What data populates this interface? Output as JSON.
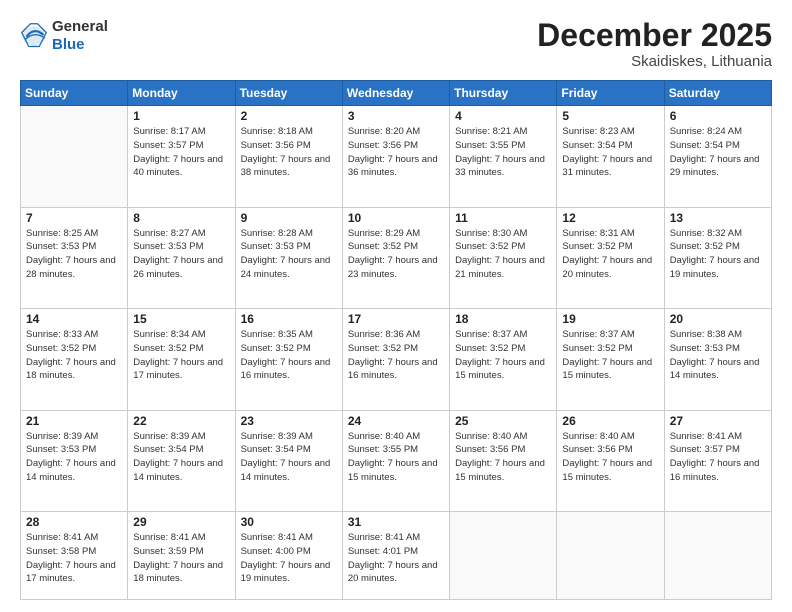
{
  "header": {
    "logo_general": "General",
    "logo_blue": "Blue",
    "month_title": "December 2025",
    "location": "Skaidiskes, Lithuania"
  },
  "days_of_week": [
    "Sunday",
    "Monday",
    "Tuesday",
    "Wednesday",
    "Thursday",
    "Friday",
    "Saturday"
  ],
  "weeks": [
    [
      {
        "day": "",
        "sunrise": "",
        "sunset": "",
        "daylight": ""
      },
      {
        "day": "1",
        "sunrise": "Sunrise: 8:17 AM",
        "sunset": "Sunset: 3:57 PM",
        "daylight": "Daylight: 7 hours and 40 minutes."
      },
      {
        "day": "2",
        "sunrise": "Sunrise: 8:18 AM",
        "sunset": "Sunset: 3:56 PM",
        "daylight": "Daylight: 7 hours and 38 minutes."
      },
      {
        "day": "3",
        "sunrise": "Sunrise: 8:20 AM",
        "sunset": "Sunset: 3:56 PM",
        "daylight": "Daylight: 7 hours and 36 minutes."
      },
      {
        "day": "4",
        "sunrise": "Sunrise: 8:21 AM",
        "sunset": "Sunset: 3:55 PM",
        "daylight": "Daylight: 7 hours and 33 minutes."
      },
      {
        "day": "5",
        "sunrise": "Sunrise: 8:23 AM",
        "sunset": "Sunset: 3:54 PM",
        "daylight": "Daylight: 7 hours and 31 minutes."
      },
      {
        "day": "6",
        "sunrise": "Sunrise: 8:24 AM",
        "sunset": "Sunset: 3:54 PM",
        "daylight": "Daylight: 7 hours and 29 minutes."
      }
    ],
    [
      {
        "day": "7",
        "sunrise": "Sunrise: 8:25 AM",
        "sunset": "Sunset: 3:53 PM",
        "daylight": "Daylight: 7 hours and 28 minutes."
      },
      {
        "day": "8",
        "sunrise": "Sunrise: 8:27 AM",
        "sunset": "Sunset: 3:53 PM",
        "daylight": "Daylight: 7 hours and 26 minutes."
      },
      {
        "day": "9",
        "sunrise": "Sunrise: 8:28 AM",
        "sunset": "Sunset: 3:53 PM",
        "daylight": "Daylight: 7 hours and 24 minutes."
      },
      {
        "day": "10",
        "sunrise": "Sunrise: 8:29 AM",
        "sunset": "Sunset: 3:52 PM",
        "daylight": "Daylight: 7 hours and 23 minutes."
      },
      {
        "day": "11",
        "sunrise": "Sunrise: 8:30 AM",
        "sunset": "Sunset: 3:52 PM",
        "daylight": "Daylight: 7 hours and 21 minutes."
      },
      {
        "day": "12",
        "sunrise": "Sunrise: 8:31 AM",
        "sunset": "Sunset: 3:52 PM",
        "daylight": "Daylight: 7 hours and 20 minutes."
      },
      {
        "day": "13",
        "sunrise": "Sunrise: 8:32 AM",
        "sunset": "Sunset: 3:52 PM",
        "daylight": "Daylight: 7 hours and 19 minutes."
      }
    ],
    [
      {
        "day": "14",
        "sunrise": "Sunrise: 8:33 AM",
        "sunset": "Sunset: 3:52 PM",
        "daylight": "Daylight: 7 hours and 18 minutes."
      },
      {
        "day": "15",
        "sunrise": "Sunrise: 8:34 AM",
        "sunset": "Sunset: 3:52 PM",
        "daylight": "Daylight: 7 hours and 17 minutes."
      },
      {
        "day": "16",
        "sunrise": "Sunrise: 8:35 AM",
        "sunset": "Sunset: 3:52 PM",
        "daylight": "Daylight: 7 hours and 16 minutes."
      },
      {
        "day": "17",
        "sunrise": "Sunrise: 8:36 AM",
        "sunset": "Sunset: 3:52 PM",
        "daylight": "Daylight: 7 hours and 16 minutes."
      },
      {
        "day": "18",
        "sunrise": "Sunrise: 8:37 AM",
        "sunset": "Sunset: 3:52 PM",
        "daylight": "Daylight: 7 hours and 15 minutes."
      },
      {
        "day": "19",
        "sunrise": "Sunrise: 8:37 AM",
        "sunset": "Sunset: 3:52 PM",
        "daylight": "Daylight: 7 hours and 15 minutes."
      },
      {
        "day": "20",
        "sunrise": "Sunrise: 8:38 AM",
        "sunset": "Sunset: 3:53 PM",
        "daylight": "Daylight: 7 hours and 14 minutes."
      }
    ],
    [
      {
        "day": "21",
        "sunrise": "Sunrise: 8:39 AM",
        "sunset": "Sunset: 3:53 PM",
        "daylight": "Daylight: 7 hours and 14 minutes."
      },
      {
        "day": "22",
        "sunrise": "Sunrise: 8:39 AM",
        "sunset": "Sunset: 3:54 PM",
        "daylight": "Daylight: 7 hours and 14 minutes."
      },
      {
        "day": "23",
        "sunrise": "Sunrise: 8:39 AM",
        "sunset": "Sunset: 3:54 PM",
        "daylight": "Daylight: 7 hours and 14 minutes."
      },
      {
        "day": "24",
        "sunrise": "Sunrise: 8:40 AM",
        "sunset": "Sunset: 3:55 PM",
        "daylight": "Daylight: 7 hours and 15 minutes."
      },
      {
        "day": "25",
        "sunrise": "Sunrise: 8:40 AM",
        "sunset": "Sunset: 3:56 PM",
        "daylight": "Daylight: 7 hours and 15 minutes."
      },
      {
        "day": "26",
        "sunrise": "Sunrise: 8:40 AM",
        "sunset": "Sunset: 3:56 PM",
        "daylight": "Daylight: 7 hours and 15 minutes."
      },
      {
        "day": "27",
        "sunrise": "Sunrise: 8:41 AM",
        "sunset": "Sunset: 3:57 PM",
        "daylight": "Daylight: 7 hours and 16 minutes."
      }
    ],
    [
      {
        "day": "28",
        "sunrise": "Sunrise: 8:41 AM",
        "sunset": "Sunset: 3:58 PM",
        "daylight": "Daylight: 7 hours and 17 minutes."
      },
      {
        "day": "29",
        "sunrise": "Sunrise: 8:41 AM",
        "sunset": "Sunset: 3:59 PM",
        "daylight": "Daylight: 7 hours and 18 minutes."
      },
      {
        "day": "30",
        "sunrise": "Sunrise: 8:41 AM",
        "sunset": "Sunset: 4:00 PM",
        "daylight": "Daylight: 7 hours and 19 minutes."
      },
      {
        "day": "31",
        "sunrise": "Sunrise: 8:41 AM",
        "sunset": "Sunset: 4:01 PM",
        "daylight": "Daylight: 7 hours and 20 minutes."
      },
      {
        "day": "",
        "sunrise": "",
        "sunset": "",
        "daylight": ""
      },
      {
        "day": "",
        "sunrise": "",
        "sunset": "",
        "daylight": ""
      },
      {
        "day": "",
        "sunrise": "",
        "sunset": "",
        "daylight": ""
      }
    ]
  ]
}
